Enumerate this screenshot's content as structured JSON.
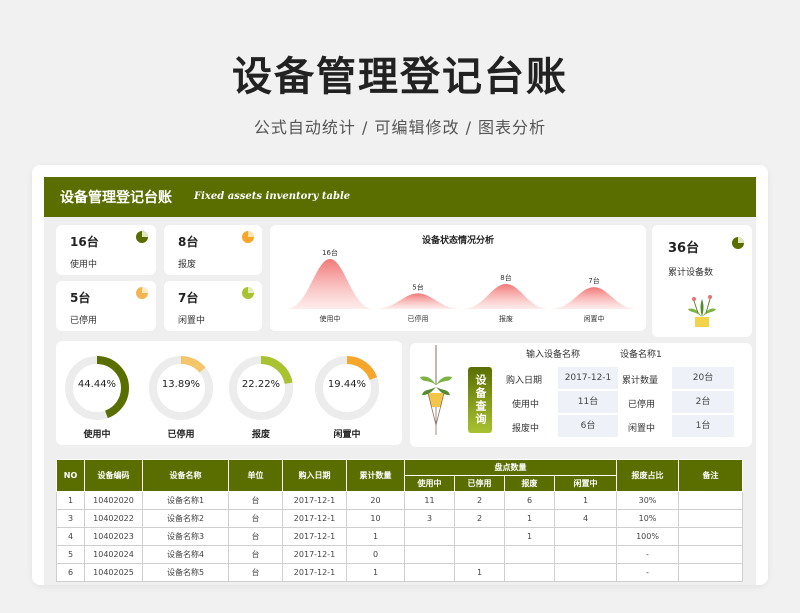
{
  "page": {
    "title": "设备管理登记台账",
    "subtitle": "公式自动统计 /  可编辑修改  /  图表分析"
  },
  "header": {
    "title": "设备管理登记台账",
    "subtitle": "Fixed assets inventory table"
  },
  "stats": [
    {
      "value": "16台",
      "label": "使用中",
      "color": "#5a6e00",
      "icon": "pie-chart-icon"
    },
    {
      "value": "8台",
      "label": "报废",
      "color": "#f4a72a",
      "icon": "pie-chart-icon"
    },
    {
      "value": "5台",
      "label": "已停用",
      "color": "#f4b451",
      "icon": "pie-chart-icon"
    },
    {
      "value": "7台",
      "label": "闲置中",
      "color": "#a8c232",
      "icon": "pie-chart-icon"
    }
  ],
  "total": {
    "value": "36台",
    "label": "累计设备数",
    "icon": "potted-plant-icon",
    "color": "#5a6e00"
  },
  "chart_data": {
    "type": "area",
    "title": "设备状态情况分析",
    "categories": [
      "使用中",
      "已停用",
      "报废",
      "闲置中"
    ],
    "values": [
      16,
      5,
      8,
      7
    ],
    "data_labels": [
      "16台",
      "5台",
      "8台",
      "7台"
    ],
    "color": "#f07070"
  },
  "donuts": [
    {
      "pct": "44.44%",
      "fraction": 0.4444,
      "label": "使用中",
      "color": "#5a6e00"
    },
    {
      "pct": "13.89%",
      "fraction": 0.1389,
      "label": "已停用",
      "color": "#f4c56a"
    },
    {
      "pct": "22.22%",
      "fraction": 0.2222,
      "label": "报废",
      "color": "#a8c232"
    },
    {
      "pct": "19.44%",
      "fraction": 0.1944,
      "label": "闲置中",
      "color": "#f4a72a"
    }
  ],
  "query": {
    "button_label": "设备查询",
    "input_label": "输入设备名称",
    "input_value": "设备名称1",
    "fields": [
      {
        "label": "购入日期",
        "value": "2017-12-1",
        "label2": "累计数量",
        "value2": "20台"
      },
      {
        "label": "使用中",
        "value": "11台",
        "label2": "已停用",
        "value2": "2台"
      },
      {
        "label": "报废中",
        "value": "6台",
        "label2": "闲置中",
        "value2": "1台"
      }
    ],
    "plant_icon": "hanging-plant-icon"
  },
  "table": {
    "headers": [
      "NO",
      "设备编码",
      "设备名称",
      "单位",
      "购入日期",
      "累计数量",
      "盘点数量",
      "报废占比",
      "备注"
    ],
    "sub_headers": [
      "使用中",
      "已停用",
      "报废",
      "闲置中"
    ],
    "rows": [
      [
        "1",
        "10402020",
        "设备名称1",
        "台",
        "2017-12-1",
        "20",
        "11",
        "2",
        "6",
        "1",
        "30%",
        ""
      ],
      [
        "3",
        "10402022",
        "设备名称2",
        "台",
        "2017-12-1",
        "10",
        "3",
        "2",
        "1",
        "4",
        "10%",
        ""
      ],
      [
        "4",
        "10402023",
        "设备名称3",
        "台",
        "2017-12-1",
        "1",
        "",
        "",
        "1",
        "",
        "100%",
        ""
      ],
      [
        "5",
        "10402024",
        "设备名称4",
        "台",
        "2017-12-1",
        "0",
        "",
        "",
        "",
        "",
        "-",
        ""
      ],
      [
        "6",
        "10402025",
        "设备名称5",
        "台",
        "2017-12-1",
        "1",
        "",
        "1",
        "",
        "",
        "-",
        ""
      ]
    ]
  }
}
